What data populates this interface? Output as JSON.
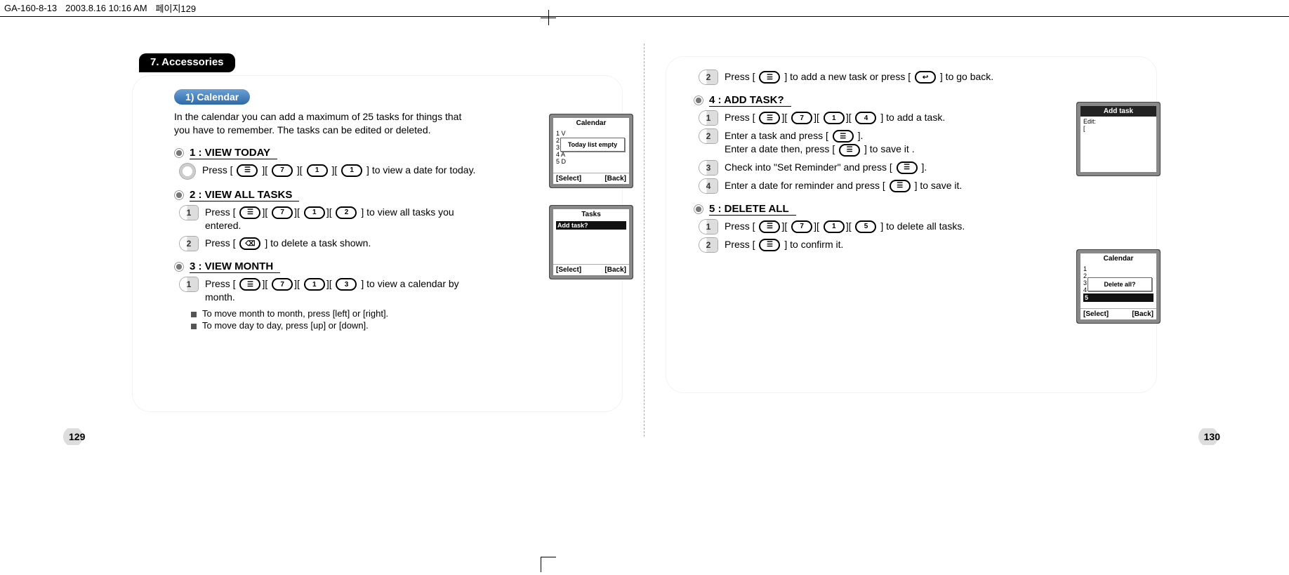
{
  "doc_header": {
    "file": "GA-160-8-13",
    "timestamp": "2003.8.16 10:16 AM",
    "page_label": "페이지129"
  },
  "section_title": "7. Accessories",
  "calendar": {
    "pill": "1) Calendar",
    "intro": "In the calendar you can add a maximum of 25 tasks for things that you have to remember. The tasks can be edited or deleted.",
    "s1": {
      "title": "1 : VIEW TODAY",
      "step": "Press [",
      "step_mid1": "][",
      "step_mid2": "][",
      "step_mid3": "][",
      "step_tail": "] to view a date for today."
    },
    "s2": {
      "title": "2 : VIEW ALL TASKS",
      "step1_a": "Press [",
      "step1_tail": "] to view all tasks you entered.",
      "step2_a": "Press [",
      "step2_tail": "] to delete a task shown."
    },
    "s3": {
      "title": "3 : VIEW MONTH",
      "step1_a": "Press [",
      "step1_tail": "] to view a calendar by month.",
      "note1": "To move month to month, press [left] or [right].",
      "note2": "To move day to day, press [up] or [down]."
    },
    "r_intro_step2_a": "Press [",
    "r_intro_step2_mid": "] to add a new task or press [",
    "r_intro_step2_tail": "] to go  back.",
    "s4": {
      "title": "4 : ADD TASK?",
      "step1_a": "Press [",
      "step1_tail": "] to add a task.",
      "step2_a": "Enter a task and press [",
      "step2_mid": "].",
      "step2_b": "Enter a date then, press [",
      "step2_tail": "] to save it .",
      "step3_a": "Check into \"Set Reminder\" and press [",
      "step3_tail": "].",
      "step4_a": "Enter a date for reminder and press [",
      "step4_tail": "] to save it."
    },
    "s5": {
      "title": "5 : DELETE ALL",
      "step1_a": "Press [",
      "step1_tail": "] to delete all tasks.",
      "step2_a": "Press [",
      "step2_tail": "] to confirm it."
    }
  },
  "phones": {
    "p1": {
      "title": "Calendar",
      "popup": "Today list empty",
      "left": "[Select]",
      "right": "[Back]",
      "rows": [
        "1 V",
        "2 V",
        "3 V",
        "4 A",
        "5 D"
      ]
    },
    "p2": {
      "title": "Tasks",
      "hi": "Add task?",
      "left": "[Select]",
      "right": "[Back]"
    },
    "p3": {
      "title": "Add task",
      "line1": "Edit:",
      "line2": "["
    },
    "p4": {
      "title": "Calendar",
      "popup": "Delete all?",
      "left": "[Select]",
      "right": "[Back]",
      "rows": [
        "1",
        "2",
        "3",
        "4",
        "5"
      ],
      "hi_row": "5"
    }
  },
  "page_left_num": "129",
  "page_right_num": "130"
}
